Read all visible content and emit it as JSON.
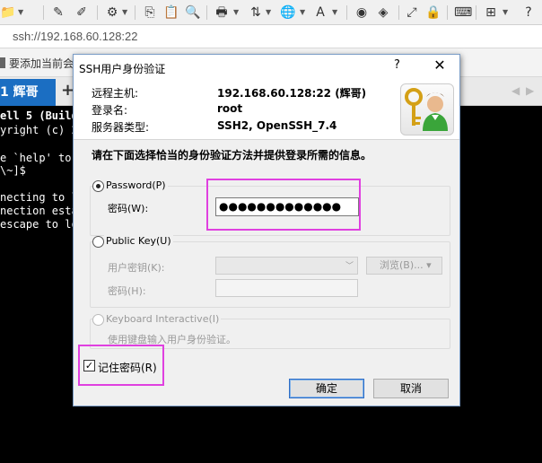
{
  "address": {
    "url": "ssh://192.168.60.128:22"
  },
  "hint": {
    "text": "要添加当前会"
  },
  "tabs": {
    "active_label": "1 辉哥",
    "add_label": "+"
  },
  "terminal": {
    "lines": [
      "ell 5 (Build",
      "yright (c) 2",
      "",
      "e `help' to",
      "\\~]$",
      "",
      "necting to l",
      "nection esta",
      "escape to lo"
    ]
  },
  "dialog": {
    "title": "SSH用户身份验证",
    "help_label": "?",
    "close_label": "✕",
    "info": {
      "host_label": "远程主机:",
      "host_value": "192.168.60.128:22 (辉哥)",
      "login_label": "登录名:",
      "login_value": "root",
      "server_label": "服务器类型:",
      "server_value": "SSH2, OpenSSH_7.4"
    },
    "description": "请在下面选择恰当的身份验证方法并提供登录所需的信息。",
    "password_group": {
      "title": "Password(P)",
      "field_label": "密码(W):",
      "value": "●●●●●●●●●●●●●"
    },
    "pubkey_group": {
      "title": "Public Key(U)",
      "user_key_label": "用户密钥(K):",
      "browse_label": "浏览(B)... ▾",
      "passphrase_label": "密码(H):"
    },
    "keyboard_group": {
      "title": "Keyboard Interactive(I)",
      "hint": "使用键盘输入用户身份验证。"
    },
    "remember_label": "记住密码(R)",
    "ok_label": "确定",
    "cancel_label": "取消"
  },
  "colors": {
    "accent": "#1b6ec2",
    "highlight": "#e040e0",
    "default_button_border": "#2e6ec6"
  }
}
